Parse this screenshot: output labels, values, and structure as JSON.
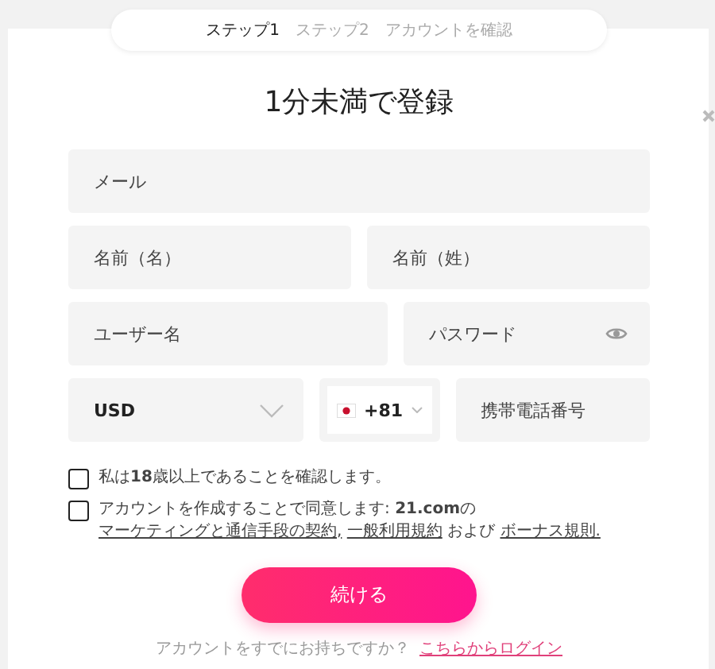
{
  "steps": [
    {
      "label": "ステップ1",
      "selected": true
    },
    {
      "label": "ステップ2",
      "selected": false
    },
    {
      "label": "アカウントを確認",
      "selected": false
    }
  ],
  "title": "1分未満で登録",
  "fields": {
    "email": {
      "placeholder": "メール"
    },
    "first_name": {
      "placeholder": "名前（名）"
    },
    "last_name": {
      "placeholder": "名前（姓）"
    },
    "username": {
      "placeholder": "ユーザー名"
    },
    "password": {
      "placeholder": "パスワード"
    },
    "currency": {
      "value": "USD"
    },
    "country_code": {
      "value": "+81"
    },
    "phone": {
      "placeholder": "携帯電話番号"
    }
  },
  "checkboxes": [
    {
      "checked": false,
      "parts": [
        {
          "kind": "text",
          "text": "私は**18**歳以上であることを確認します。"
        }
      ]
    },
    {
      "checked": false,
      "parts": [
        {
          "kind": "text",
          "text": "アカウントを作成することで同意します: **21.com**の"
        },
        {
          "kind": "link",
          "text": "マーケティングと通信手段の契約,"
        },
        {
          "kind": "link",
          "text": "一般利用規約"
        },
        {
          "kind": "text",
          "text": "および"
        },
        {
          "kind": "link",
          "text": "ボーナス規則."
        }
      ]
    }
  ],
  "continue_button": "続ける",
  "login_prompt": {
    "text": "アカウントをすでにお持ちですか？",
    "link": "こちらからログイン"
  }
}
